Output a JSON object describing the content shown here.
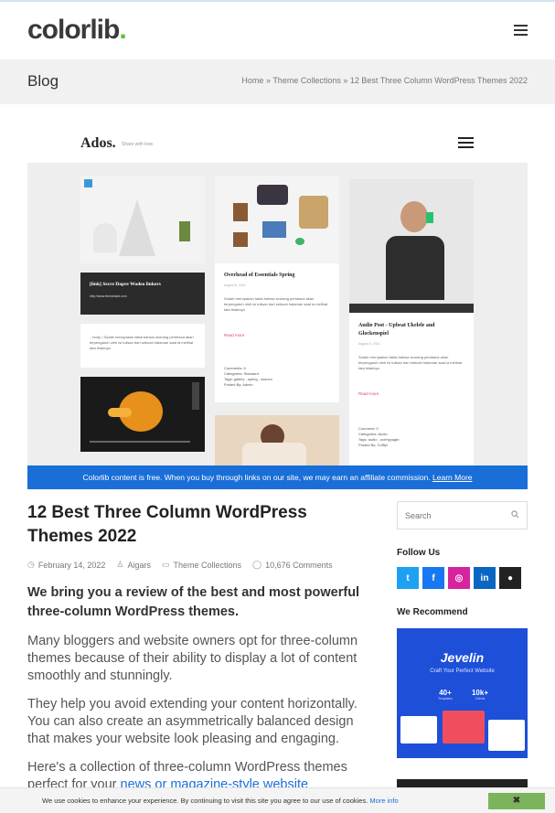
{
  "header": {
    "logo": "colorlib",
    "logo_dot": ".",
    "menu_icon": "hamburger-icon"
  },
  "crumbbar": {
    "title": "Blog",
    "crumbs": [
      "Home",
      "Theme Collections",
      "12 Best Three Column WordPress Themes 2022"
    ],
    "sep": "»"
  },
  "feature": {
    "site_name": "Ados.",
    "tagline": "Share with love.",
    "cards": {
      "link_title": "[link] Secre Dapre Wodeo linkers",
      "link_url": "http://www.themeskid.com",
      "quote_text": "...body / Sudah merupakan fakta bahwa seorang pembaca akan terpengaruh oleh isi tulisan dari sebuah halaman saat ia melihat tata letaknya",
      "post1_title": "Overhead of Essentials Spring",
      "post1_date": "August 6, 2014",
      "post1_text": "Sudah merupakan fakta bahwa seorang pembaca akan terpengaruh oleh isi tulisan dari sebuah halaman saat ia melihat tata letaknya",
      "post1_more": "Read more",
      "post1_foot": [
        "Comments: 6",
        "Categories: Standard",
        "Tags: gallery , spring , women",
        "Posted By: Admin"
      ],
      "post2_title": "Audio Post - Upbeat Ukelele and Glockenspiel",
      "post2_date": "August 6, 2014",
      "post2_text": "Sudah merupakan fakta bahwa seorang pembaca akan terpengaruh oleh isi tulisan dari sebuah halaman saat ia melihat tata letaknya",
      "post2_more": "Read more",
      "post2_foot": [
        "Comment: 0",
        "Categories: Audio",
        "Tags: audio , overtypagle",
        "Posted By: Coffiyt"
      ]
    }
  },
  "affiliate": {
    "text": "Colorlib content is free. When you buy through links on our site, we may earn an affiliate commission.",
    "link": "Learn More"
  },
  "article": {
    "title": "12 Best Three Column WordPress Themes 2022",
    "date": "February 14, 2022",
    "author": "Aigars",
    "category": "Theme Collections",
    "comments": "10,676 Comments",
    "lead": "We bring you a review of the best and most powerful three-column WordPress themes.",
    "p1": "Many bloggers and website owners opt for three-column themes because of their ability to display a lot of content smoothly and stunningly.",
    "p2": "They help you avoid extending your content horizontally. You can also create an asymmetrically balanced design that makes your website look pleasing and engaging.",
    "p3_before": "Here's a collection of three-column WordPress themes perfect for your ",
    "p3_link": "news or magazine-style website"
  },
  "sidebar": {
    "search_placeholder": "Search",
    "follow_heading": "Follow Us",
    "social": [
      {
        "icon": "twitter-icon",
        "glyph": "t",
        "color": "#1da1f2"
      },
      {
        "icon": "facebook-icon",
        "glyph": "f",
        "color": "#1877f2"
      },
      {
        "icon": "instagram-icon",
        "glyph": "◎",
        "color": "#d6249f"
      },
      {
        "icon": "linkedin-icon",
        "glyph": "in",
        "color": "#0a66c2"
      },
      {
        "icon": "github-icon",
        "glyph": "●",
        "color": "#222222"
      }
    ],
    "recommend_heading": "We Recommend",
    "rec_brand": "Jevelin",
    "rec_sub": "Craft Your Perfect Website",
    "rec_stat1": "40+",
    "rec_stat1_label": "Templates",
    "rec_stat2": "10k+",
    "rec_stat2_label": "Clients"
  },
  "cookie": {
    "text": "We use cookies to enhance your experience. By continuing to visit this site you agree to our use of cookies.",
    "link": "More info",
    "close": "✖"
  },
  "colors": {
    "accent": "#1a6ed8",
    "logo_dot": "#5fbe3c",
    "cookie_button": "#7ab55c"
  }
}
